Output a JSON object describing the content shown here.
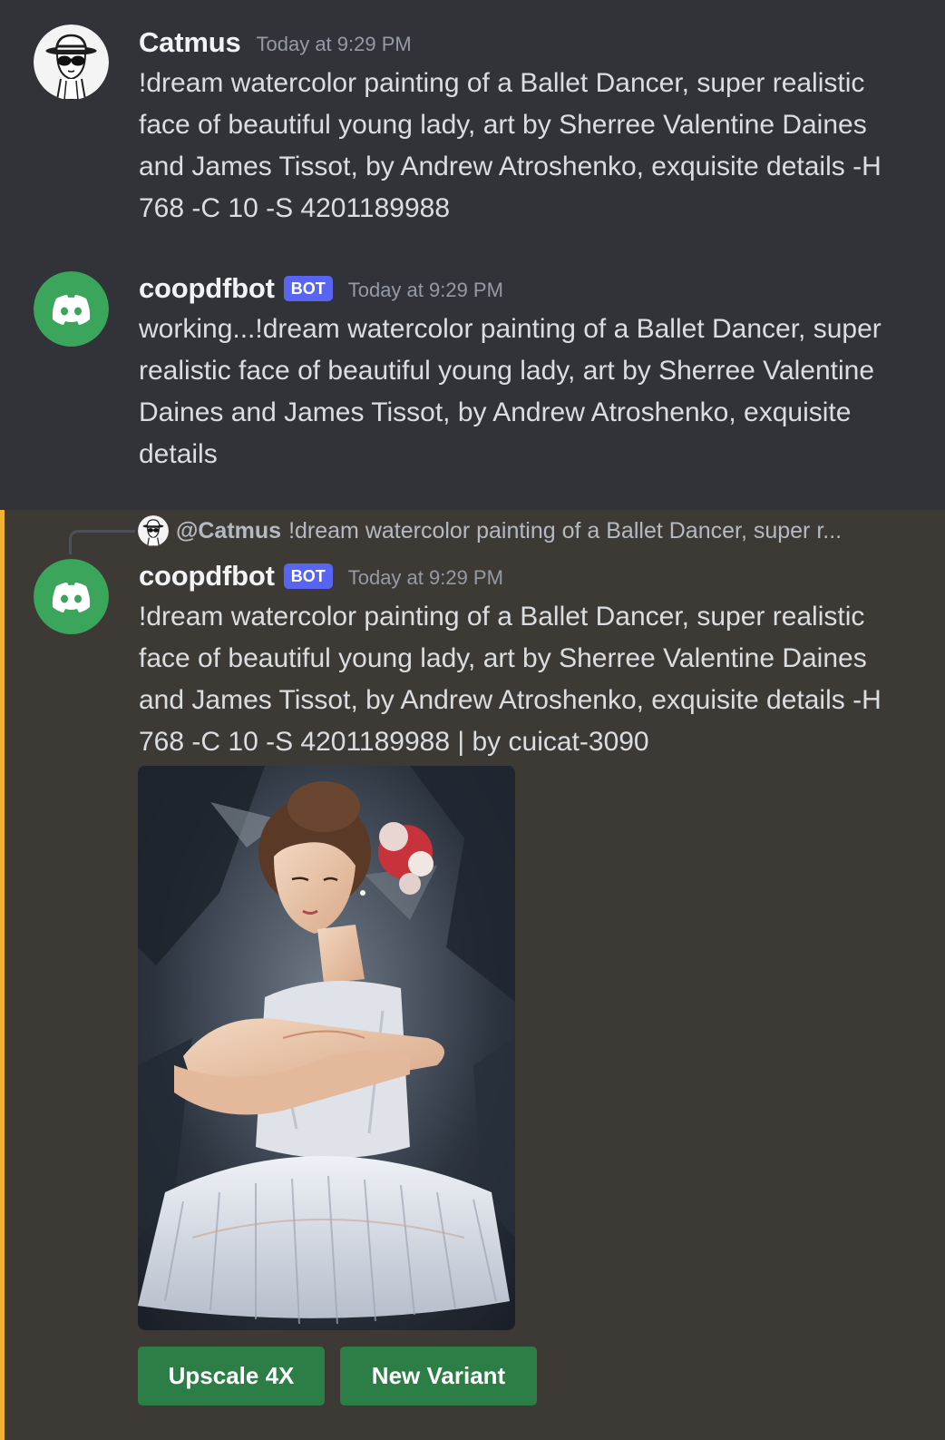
{
  "messages": [
    {
      "username": "Catmus",
      "timestamp": "Today at 9:29 PM",
      "text": "!dream watercolor painting of a Ballet Dancer, super realistic face of beautiful young lady, art by Sherree Valentine Daines and James Tissot, by Andrew Atroshenko, exquisite details -H 768 -C 10 -S 4201189988"
    },
    {
      "username": "coopdfbot",
      "bot_tag": "BOT",
      "timestamp": "Today at 9:29 PM",
      "text": "working...!dream watercolor painting of a Ballet Dancer, super realistic face of beautiful young lady, art by Sherree Valentine Daines and James Tissot, by Andrew Atroshenko, exquisite details"
    },
    {
      "reply_to": {
        "mention": "@Catmus",
        "text": "!dream watercolor painting of a Ballet Dancer, super r..."
      },
      "username": "coopdfbot",
      "bot_tag": "BOT",
      "timestamp": "Today at 9:29 PM",
      "text": "!dream watercolor painting of a Ballet Dancer, super realistic face of beautiful young lady, art by Sherree Valentine Daines and James Tissot, by Andrew Atroshenko, exquisite details -H 768 -C 10 -S 4201189988 | by cuicat-3090",
      "buttons": [
        "Upscale 4X",
        "New Variant"
      ]
    }
  ],
  "colors": {
    "background": "#313338",
    "highlight_background": "#3d3a36",
    "highlight_bar": "#f0b232",
    "bot_tag": "#5865f2",
    "bot_avatar": "#3ba55c",
    "button": "#2d7d46"
  },
  "icons": {
    "user_avatar": "cat-with-hat-and-sunglasses",
    "bot_avatar": "discord-logo"
  }
}
